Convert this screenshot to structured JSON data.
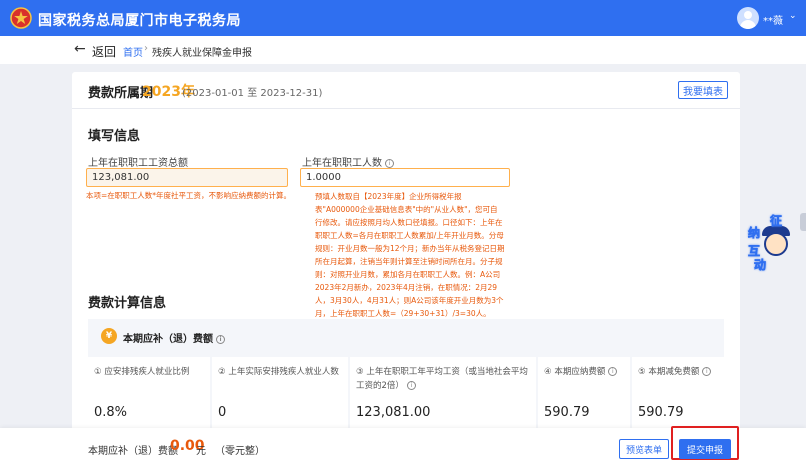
{
  "header": {
    "site_title": "国家税务总局厦门市电子税务局",
    "username": "**薇",
    "user_caret": "⌄"
  },
  "nav": {
    "back_arrow": "←",
    "back_label": "返回",
    "breadcrumb_home": "首页",
    "breadcrumb_sep": "›",
    "breadcrumb_current": "残疾人就业保障金申报"
  },
  "period": {
    "label": "费款所属期",
    "year": "2023年",
    "range": "(2023-01-01 至 2023-12-31)",
    "fill_button": "我要填表"
  },
  "fill_info": {
    "title": "填写信息",
    "total_salary_label": "上年在职职工工资总额",
    "total_salary_value": "123,081.00",
    "total_salary_hint": "本项=在职职工人数*年度社平工资，不影响应纳费额的计算。",
    "employee_count_label": "上年在职职工人数",
    "employee_count_value": "1.0000",
    "employee_count_hint": "预填人数取自【2023年度】企业所得税年报表\"A000000企业基础信息表\"中的\"从业人数\"，您可自行修改。请应按照月均人数口径填报。口径如下：上年在职职工人数=各月在职职工人数累加/上年开业月数。分母规则：开业月数一般为12个月；新办当年从税务登记日期所在月起算，注销当年则计算至注销时间所在月。分子规则：对照开业月数，累加各月在职职工人数。例：A公司2023年2月新办，2023年4月注销，在职情况：2月29人，3月30人，4月31人；则A公司该年度开业月数为3个月，上年在职职工人数=（29+30+31）/3=30人。"
  },
  "fee_calc": {
    "title": "费款计算信息",
    "panel_badge": "¥",
    "panel_title": "本期应补（退）费额",
    "cells": [
      {
        "label": "① 应安排残疾人就业比例",
        "value": "0.8%"
      },
      {
        "label": "② 上年实际安排残疾人就业人数",
        "value": "0"
      },
      {
        "label": "③ 上年在职职工年平均工资（或当地社会平均工资的2倍）",
        "value": "123,081.00"
      },
      {
        "label": "④ 本期应纳费额",
        "value": "590.79"
      },
      {
        "label": "⑤ 本期减免费额",
        "value": "590.79"
      }
    ]
  },
  "bottom": {
    "label": "本期应补（退）费额",
    "amount": "0.00",
    "unit": "元",
    "amount_words": "（零元整）",
    "preview_button": "预览表单",
    "submit_button": "提交申报"
  },
  "assistant": {
    "chars": [
      "征",
      "纳",
      "互",
      "动"
    ]
  },
  "colors": {
    "brand_blue": "#2f6ff0",
    "accent_orange": "#f5a623",
    "warning_red": "#e8590c",
    "highlight_frame": "#e02020"
  }
}
